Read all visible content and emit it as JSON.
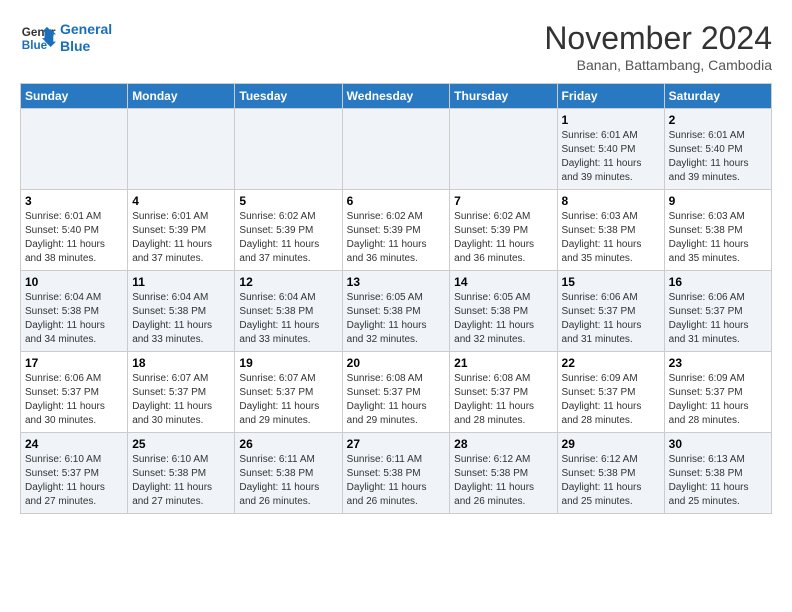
{
  "logo": {
    "line1": "General",
    "line2": "Blue"
  },
  "title": "November 2024",
  "subtitle": "Banan, Battambang, Cambodia",
  "weekdays": [
    "Sunday",
    "Monday",
    "Tuesday",
    "Wednesday",
    "Thursday",
    "Friday",
    "Saturday"
  ],
  "weeks": [
    [
      {
        "day": "",
        "info": ""
      },
      {
        "day": "",
        "info": ""
      },
      {
        "day": "",
        "info": ""
      },
      {
        "day": "",
        "info": ""
      },
      {
        "day": "",
        "info": ""
      },
      {
        "day": "1",
        "info": "Sunrise: 6:01 AM\nSunset: 5:40 PM\nDaylight: 11 hours and 39 minutes."
      },
      {
        "day": "2",
        "info": "Sunrise: 6:01 AM\nSunset: 5:40 PM\nDaylight: 11 hours and 39 minutes."
      }
    ],
    [
      {
        "day": "3",
        "info": "Sunrise: 6:01 AM\nSunset: 5:40 PM\nDaylight: 11 hours and 38 minutes."
      },
      {
        "day": "4",
        "info": "Sunrise: 6:01 AM\nSunset: 5:39 PM\nDaylight: 11 hours and 37 minutes."
      },
      {
        "day": "5",
        "info": "Sunrise: 6:02 AM\nSunset: 5:39 PM\nDaylight: 11 hours and 37 minutes."
      },
      {
        "day": "6",
        "info": "Sunrise: 6:02 AM\nSunset: 5:39 PM\nDaylight: 11 hours and 36 minutes."
      },
      {
        "day": "7",
        "info": "Sunrise: 6:02 AM\nSunset: 5:39 PM\nDaylight: 11 hours and 36 minutes."
      },
      {
        "day": "8",
        "info": "Sunrise: 6:03 AM\nSunset: 5:38 PM\nDaylight: 11 hours and 35 minutes."
      },
      {
        "day": "9",
        "info": "Sunrise: 6:03 AM\nSunset: 5:38 PM\nDaylight: 11 hours and 35 minutes."
      }
    ],
    [
      {
        "day": "10",
        "info": "Sunrise: 6:04 AM\nSunset: 5:38 PM\nDaylight: 11 hours and 34 minutes."
      },
      {
        "day": "11",
        "info": "Sunrise: 6:04 AM\nSunset: 5:38 PM\nDaylight: 11 hours and 33 minutes."
      },
      {
        "day": "12",
        "info": "Sunrise: 6:04 AM\nSunset: 5:38 PM\nDaylight: 11 hours and 33 minutes."
      },
      {
        "day": "13",
        "info": "Sunrise: 6:05 AM\nSunset: 5:38 PM\nDaylight: 11 hours and 32 minutes."
      },
      {
        "day": "14",
        "info": "Sunrise: 6:05 AM\nSunset: 5:38 PM\nDaylight: 11 hours and 32 minutes."
      },
      {
        "day": "15",
        "info": "Sunrise: 6:06 AM\nSunset: 5:37 PM\nDaylight: 11 hours and 31 minutes."
      },
      {
        "day": "16",
        "info": "Sunrise: 6:06 AM\nSunset: 5:37 PM\nDaylight: 11 hours and 31 minutes."
      }
    ],
    [
      {
        "day": "17",
        "info": "Sunrise: 6:06 AM\nSunset: 5:37 PM\nDaylight: 11 hours and 30 minutes."
      },
      {
        "day": "18",
        "info": "Sunrise: 6:07 AM\nSunset: 5:37 PM\nDaylight: 11 hours and 30 minutes."
      },
      {
        "day": "19",
        "info": "Sunrise: 6:07 AM\nSunset: 5:37 PM\nDaylight: 11 hours and 29 minutes."
      },
      {
        "day": "20",
        "info": "Sunrise: 6:08 AM\nSunset: 5:37 PM\nDaylight: 11 hours and 29 minutes."
      },
      {
        "day": "21",
        "info": "Sunrise: 6:08 AM\nSunset: 5:37 PM\nDaylight: 11 hours and 28 minutes."
      },
      {
        "day": "22",
        "info": "Sunrise: 6:09 AM\nSunset: 5:37 PM\nDaylight: 11 hours and 28 minutes."
      },
      {
        "day": "23",
        "info": "Sunrise: 6:09 AM\nSunset: 5:37 PM\nDaylight: 11 hours and 28 minutes."
      }
    ],
    [
      {
        "day": "24",
        "info": "Sunrise: 6:10 AM\nSunset: 5:37 PM\nDaylight: 11 hours and 27 minutes."
      },
      {
        "day": "25",
        "info": "Sunrise: 6:10 AM\nSunset: 5:38 PM\nDaylight: 11 hours and 27 minutes."
      },
      {
        "day": "26",
        "info": "Sunrise: 6:11 AM\nSunset: 5:38 PM\nDaylight: 11 hours and 26 minutes."
      },
      {
        "day": "27",
        "info": "Sunrise: 6:11 AM\nSunset: 5:38 PM\nDaylight: 11 hours and 26 minutes."
      },
      {
        "day": "28",
        "info": "Sunrise: 6:12 AM\nSunset: 5:38 PM\nDaylight: 11 hours and 26 minutes."
      },
      {
        "day": "29",
        "info": "Sunrise: 6:12 AM\nSunset: 5:38 PM\nDaylight: 11 hours and 25 minutes."
      },
      {
        "day": "30",
        "info": "Sunrise: 6:13 AM\nSunset: 5:38 PM\nDaylight: 11 hours and 25 minutes."
      }
    ]
  ]
}
